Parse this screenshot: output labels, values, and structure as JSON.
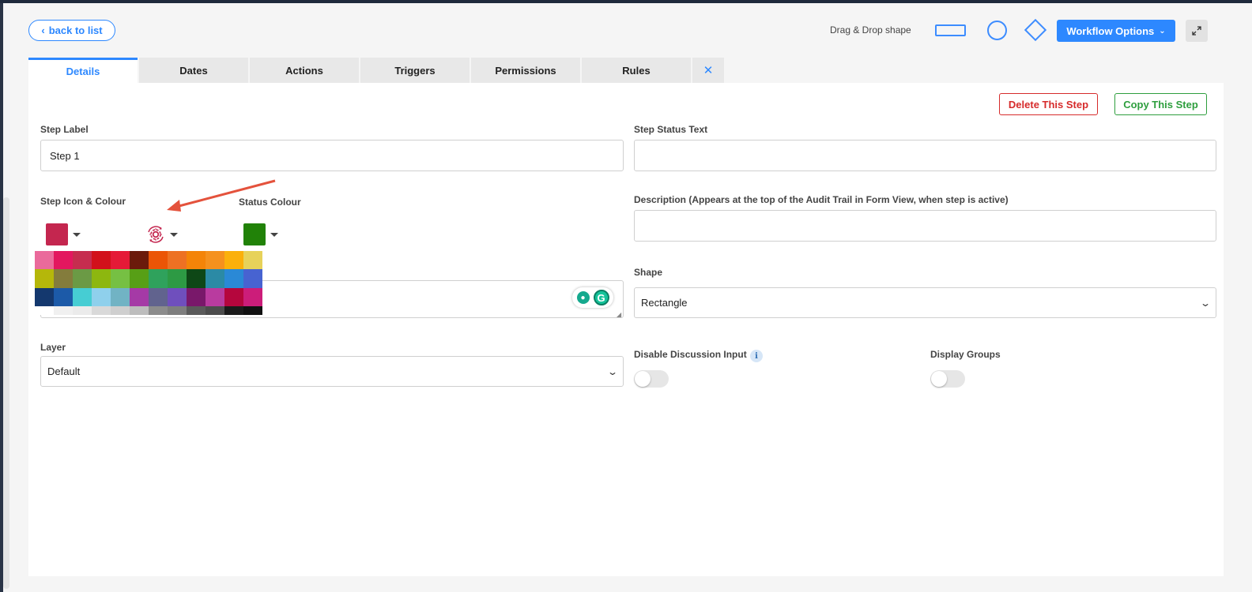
{
  "header": {
    "back_label": "back to list",
    "drag_drop_label": "Drag & Drop shape",
    "workflow_options_label": "Workflow Options",
    "icons": {
      "back": "chevron-left-icon",
      "caret": "chevron-down-icon",
      "expand": "expand-icon"
    }
  },
  "tabs": [
    {
      "label": "Details",
      "active": true
    },
    {
      "label": "Dates"
    },
    {
      "label": "Actions"
    },
    {
      "label": "Triggers"
    },
    {
      "label": "Permissions"
    },
    {
      "label": "Rules"
    }
  ],
  "tab_close_symbol": "✕",
  "actions": {
    "delete_label": "Delete This Step",
    "copy_label": "Copy This Step"
  },
  "form": {
    "step_label": {
      "label": "Step Label",
      "value": "Step 1"
    },
    "step_status_text": {
      "label": "Step Status Text",
      "value": ""
    },
    "step_icon_colour": {
      "label": "Step Icon & Colour",
      "colour": "#c4264f",
      "icon": "cog-refresh-icon"
    },
    "status_colour": {
      "label": "Status Colour",
      "colour": "#218208"
    },
    "description": {
      "label": "Description (Appears at the top of the Audit Trail in Form View, when step is active)",
      "value": ""
    },
    "shape": {
      "label": "Shape",
      "value": "Rectangle"
    },
    "layer": {
      "label": "Layer",
      "value": "Default"
    },
    "disable_discussion_input": {
      "label": "Disable Discussion Input",
      "on": false
    },
    "display_groups": {
      "label": "Display Groups",
      "on": false
    }
  },
  "palette": {
    "rows": [
      [
        "#ea6a9b",
        "#e3175f",
        "#c62d4f",
        "#d2111b",
        "#e51a37",
        "#6b1a0b",
        "#eb5506",
        "#ed7123",
        "#f48408",
        "#f5911e",
        "#fbb00b",
        "#e7d25a"
      ],
      [
        "#b5b70a",
        "#847c3c",
        "#6b9a45",
        "#8db70f",
        "#76c043",
        "#579f16",
        "#2fa25c",
        "#2d9a44",
        "#0e4716",
        "#2b8aa5",
        "#2a89d6",
        "#4763d1"
      ],
      [
        "#14386e",
        "#1c5aa8",
        "#46cdd3",
        "#8fd0ec",
        "#71b3c4",
        "#a53aa6",
        "#61638e",
        "#6f4fbd",
        "#79186a",
        "#b93b9f",
        "#b5063d",
        "#cc1d7a"
      ],
      [
        "#ffffff",
        "#f0f0f0",
        "#ebebeb",
        "#d9d9d9",
        "#cfcfcf",
        "#bdbdbd",
        "#8c8c8c",
        "#7e7e7e",
        "#5a5a5a",
        "#4c4c4c",
        "#1b1b1b",
        "#111111"
      ]
    ]
  },
  "annotation": {
    "color": "#e4523c"
  }
}
